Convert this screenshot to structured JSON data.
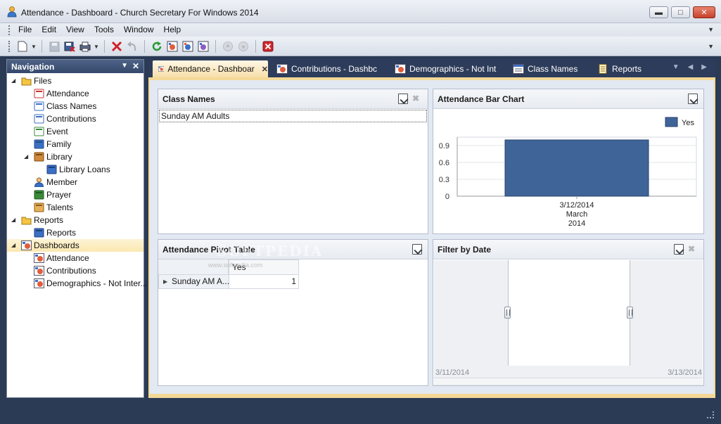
{
  "window": {
    "title": "Attendance - Dashboard - Church Secretary For Windows 2014"
  },
  "menu": [
    "File",
    "Edit",
    "View",
    "Tools",
    "Window",
    "Help"
  ],
  "navigation": {
    "title": "Navigation",
    "tree": [
      {
        "label": "Files",
        "level": 0,
        "expanded": true,
        "icon": "folder-icon"
      },
      {
        "label": "Attendance",
        "level": 1,
        "icon": "calendar-icon"
      },
      {
        "label": "Class Names",
        "level": 1,
        "icon": "list-icon"
      },
      {
        "label": "Contributions",
        "level": 1,
        "icon": "window-icon"
      },
      {
        "label": "Event",
        "level": 1,
        "icon": "event-icon"
      },
      {
        "label": "Family",
        "level": 1,
        "icon": "house-icon"
      },
      {
        "label": "Library",
        "level": 1,
        "expanded": true,
        "icon": "library-icon"
      },
      {
        "label": "Library Loans",
        "level": 2,
        "icon": "book-icon"
      },
      {
        "label": "Member",
        "level": 1,
        "icon": "person-icon"
      },
      {
        "label": "Prayer",
        "level": 1,
        "icon": "prayer-icon"
      },
      {
        "label": "Talents",
        "level": 1,
        "icon": "palette-icon"
      },
      {
        "label": "Reports",
        "level": 0,
        "expanded": true,
        "icon": "folder-icon"
      },
      {
        "label": "Reports",
        "level": 1,
        "icon": "report-icon"
      },
      {
        "label": "Dashboards",
        "level": 0,
        "expanded": true,
        "selected": true,
        "icon": "dashboard-icon"
      },
      {
        "label": "Attendance",
        "level": 1,
        "icon": "dashboard-icon"
      },
      {
        "label": "Contributions",
        "level": 1,
        "icon": "dashboard-icon"
      },
      {
        "label": "Demographics - Not Inter...",
        "level": 1,
        "icon": "dashboard-icon"
      }
    ]
  },
  "tabs": [
    {
      "label": "Attendance - Dashboar",
      "active": true
    },
    {
      "label": "Contributions  - Dashbc"
    },
    {
      "label": "Demographics - Not Int"
    },
    {
      "label": "Class Names"
    },
    {
      "label": "Reports"
    }
  ],
  "class_names": {
    "title": "Class Names",
    "items": [
      "Sunday AM Adults"
    ]
  },
  "bar_chart_panel": {
    "title": "Attendance Bar Chart"
  },
  "chart_data": {
    "type": "bar",
    "categories": [
      "3/12/2014\nMarch\n2014"
    ],
    "category_lines": [
      "3/12/2014",
      "March",
      "2014"
    ],
    "series": [
      {
        "name": "Yes",
        "values": [
          1.0
        ],
        "color": "#3f6498"
      }
    ],
    "y_ticks": [
      "0",
      "0.3",
      "0.6",
      "0.9"
    ],
    "ylim": [
      0,
      1.05
    ],
    "legend": "top-right",
    "grid": true
  },
  "pivot": {
    "title": "Attendance Pivot Table",
    "column_header": "Yes",
    "row_header": "Sunday AM A...",
    "value": "1"
  },
  "filter_by_date": {
    "title": "Filter by Date",
    "start": "3/11/2014",
    "end": "3/13/2014"
  },
  "watermark": {
    "text": "SOFTPEDIA",
    "sub": "www.softpedia.com"
  },
  "colors": {
    "accent": "#f4d897",
    "nav_header": "#3f5477",
    "bar": "#3f6498",
    "chrome": "#2d3c5a"
  }
}
